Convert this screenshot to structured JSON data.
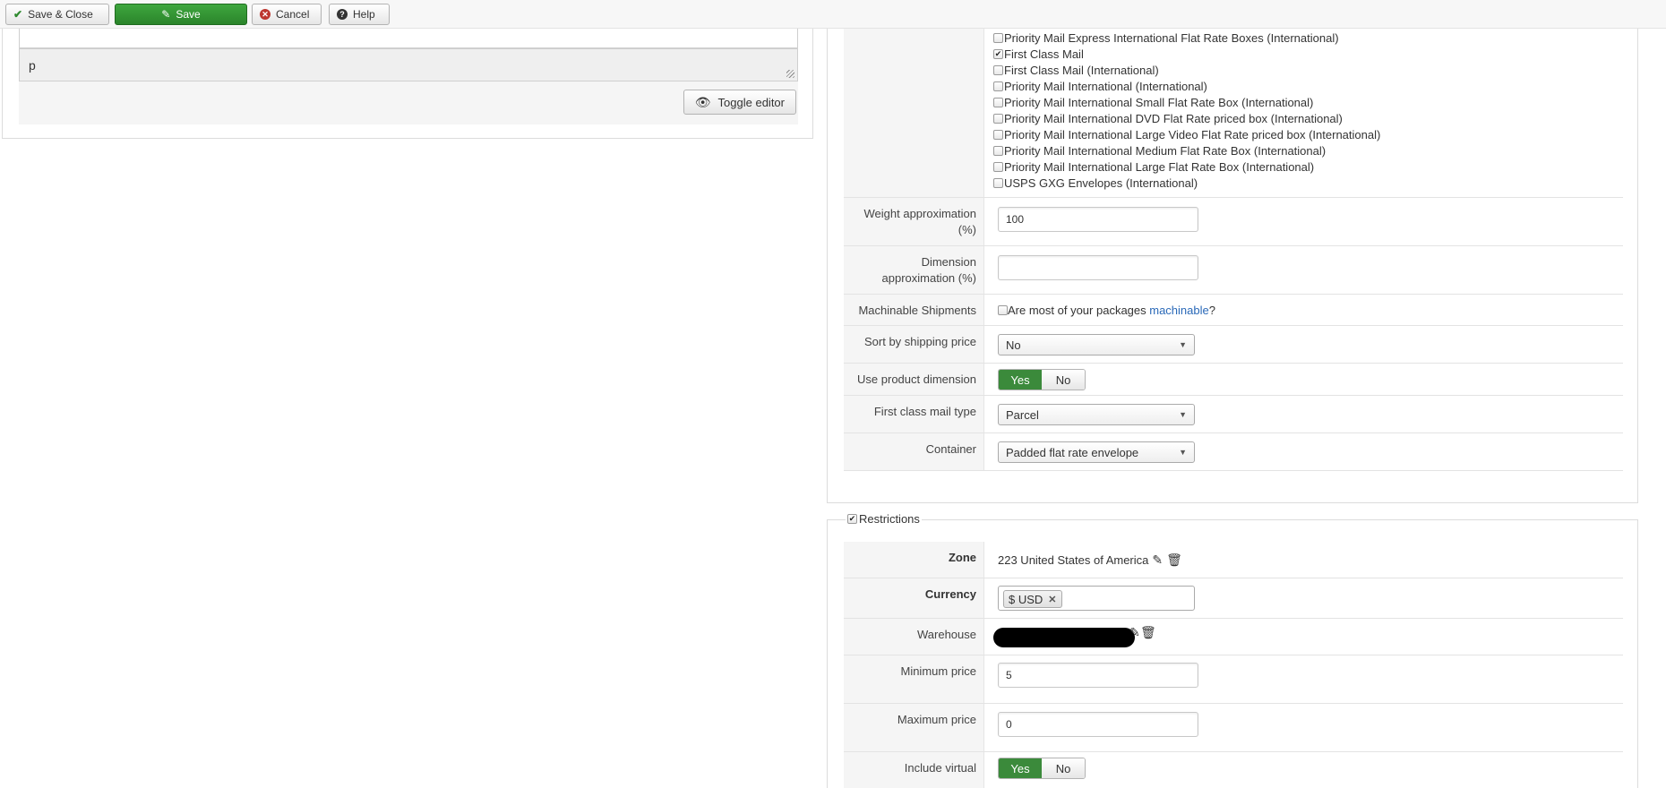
{
  "toolbar": {
    "save_close": "Save & Close",
    "save": "Save",
    "cancel": "Cancel",
    "help": "Help"
  },
  "editor": {
    "status_path": "p",
    "toggle_label": "Toggle editor"
  },
  "shipping": {
    "services": [
      {
        "label": "Priority Mail Express International Flat Rate Boxes (International)",
        "checked": false
      },
      {
        "label": "First Class Mail",
        "checked": true
      },
      {
        "label": "First Class Mail (International)",
        "checked": false
      },
      {
        "label": "Priority Mail International (International)",
        "checked": false
      },
      {
        "label": "Priority Mail International Small Flat Rate Box (International)",
        "checked": false
      },
      {
        "label": "Priority Mail International DVD Flat Rate priced box (International)",
        "checked": false
      },
      {
        "label": "Priority Mail International Large Video Flat Rate priced box (International)",
        "checked": false
      },
      {
        "label": "Priority Mail International Medium Flat Rate Box (International)",
        "checked": false
      },
      {
        "label": "Priority Mail International Large Flat Rate Box (International)",
        "checked": false
      },
      {
        "label": "USPS GXG Envelopes (International)",
        "checked": false
      }
    ],
    "weight_label": "Weight approximation (%)",
    "weight_value": "100",
    "dimension_label": "Dimension approximation (%)",
    "dimension_value": "",
    "machinable_label": "Machinable Shipments",
    "machinable_text_before": "Are most of your packages ",
    "machinable_link": "machinable",
    "machinable_text_after": "?",
    "sort_label": "Sort by shipping price",
    "sort_value": "No",
    "use_dim_label": "Use product dimension",
    "yes": "Yes",
    "no": "No",
    "first_class_label": "First class mail type",
    "first_class_value": "Parcel",
    "container_label": "Container",
    "container_value": "Padded flat rate envelope"
  },
  "restrictions": {
    "legend": "Restrictions",
    "zone_label": "Zone",
    "zone_value": "223 United States of America",
    "currency_label": "Currency",
    "currency_chip": "$ USD",
    "warehouse_label": "Warehouse",
    "min_price_label": "Minimum price",
    "min_price_value": "5",
    "max_price_label": "Maximum price",
    "max_price_value": "0",
    "include_virtual_label": "Include virtual"
  }
}
